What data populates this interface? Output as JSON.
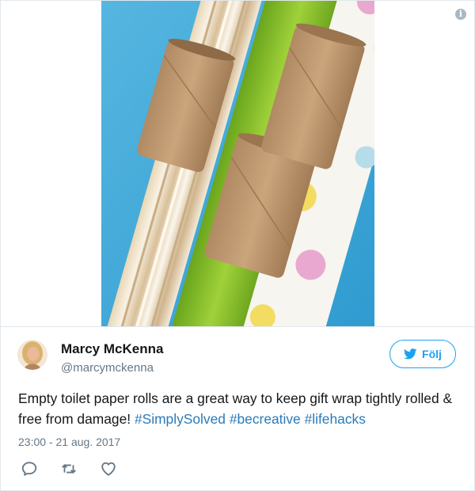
{
  "tweet": {
    "author_name": "Marcy McKenna",
    "author_handle": "@marcymckenna",
    "follow_label": "Följ",
    "text_main": "Empty toilet paper rolls are a great way to keep gift wrap tightly rolled & free from damage!",
    "hashtags": [
      "#SimplySolved",
      "#becreative",
      "#lifehacks"
    ],
    "timestamp": "23:00 - 21 aug. 2017",
    "info_glyph": "i"
  },
  "icons": {
    "info": "info-icon",
    "bird": "twitter-bird-icon",
    "reply": "reply-icon",
    "retweet": "retweet-icon",
    "like": "heart-icon"
  },
  "colors": {
    "accent": "#1da1f2",
    "hashtag": "#2b7bb9",
    "muted": "#657786",
    "photo_background": "#3fa8d8"
  }
}
